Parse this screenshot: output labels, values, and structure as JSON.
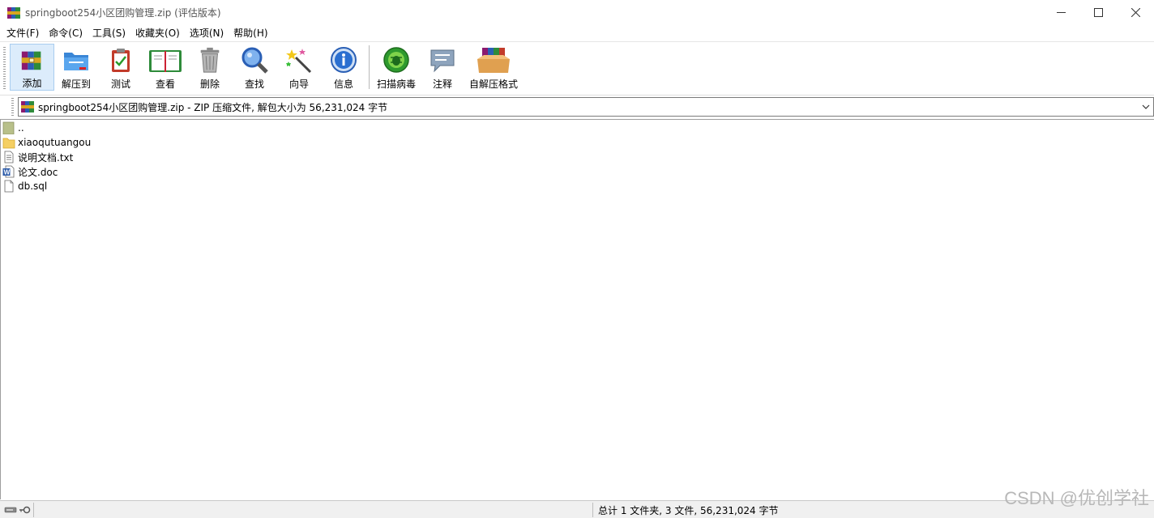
{
  "window": {
    "title": "springboot254小区团购管理.zip (评估版本)"
  },
  "menu": {
    "items": [
      "文件(F)",
      "命令(C)",
      "工具(S)",
      "收藏夹(O)",
      "选项(N)",
      "帮助(H)"
    ]
  },
  "toolbar": {
    "buttons": [
      {
        "label": "添加",
        "icon": "add-books-icon"
      },
      {
        "label": "解压到",
        "icon": "extract-folder-icon"
      },
      {
        "label": "测试",
        "icon": "test-clipboard-icon"
      },
      {
        "label": "查看",
        "icon": "view-book-icon"
      },
      {
        "label": "删除",
        "icon": "trash-icon"
      },
      {
        "label": "查找",
        "icon": "magnifier-icon"
      },
      {
        "label": "向导",
        "icon": "wizard-wand-icon"
      },
      {
        "label": "信息",
        "icon": "info-icon"
      },
      {
        "label": "扫描病毒",
        "icon": "virus-scan-icon"
      },
      {
        "label": "注释",
        "icon": "comment-icon"
      },
      {
        "label": "自解压格式",
        "icon": "sfx-box-icon"
      }
    ]
  },
  "address": {
    "text": "springboot254小区团购管理.zip - ZIP 压缩文件, 解包大小为 56,231,024 字节"
  },
  "files": [
    {
      "name": "..",
      "icon": "parent-folder-icon"
    },
    {
      "name": "xiaoqutuangou",
      "icon": "folder-icon"
    },
    {
      "name": "说明文档.txt",
      "icon": "text-file-icon"
    },
    {
      "name": "论文.doc",
      "icon": "word-doc-icon"
    },
    {
      "name": "db.sql",
      "icon": "generic-file-icon"
    }
  ],
  "status": {
    "summary": "总计 1 文件夹, 3 文件, 56,231,024 字节"
  },
  "watermark": "CSDN @优创学社"
}
